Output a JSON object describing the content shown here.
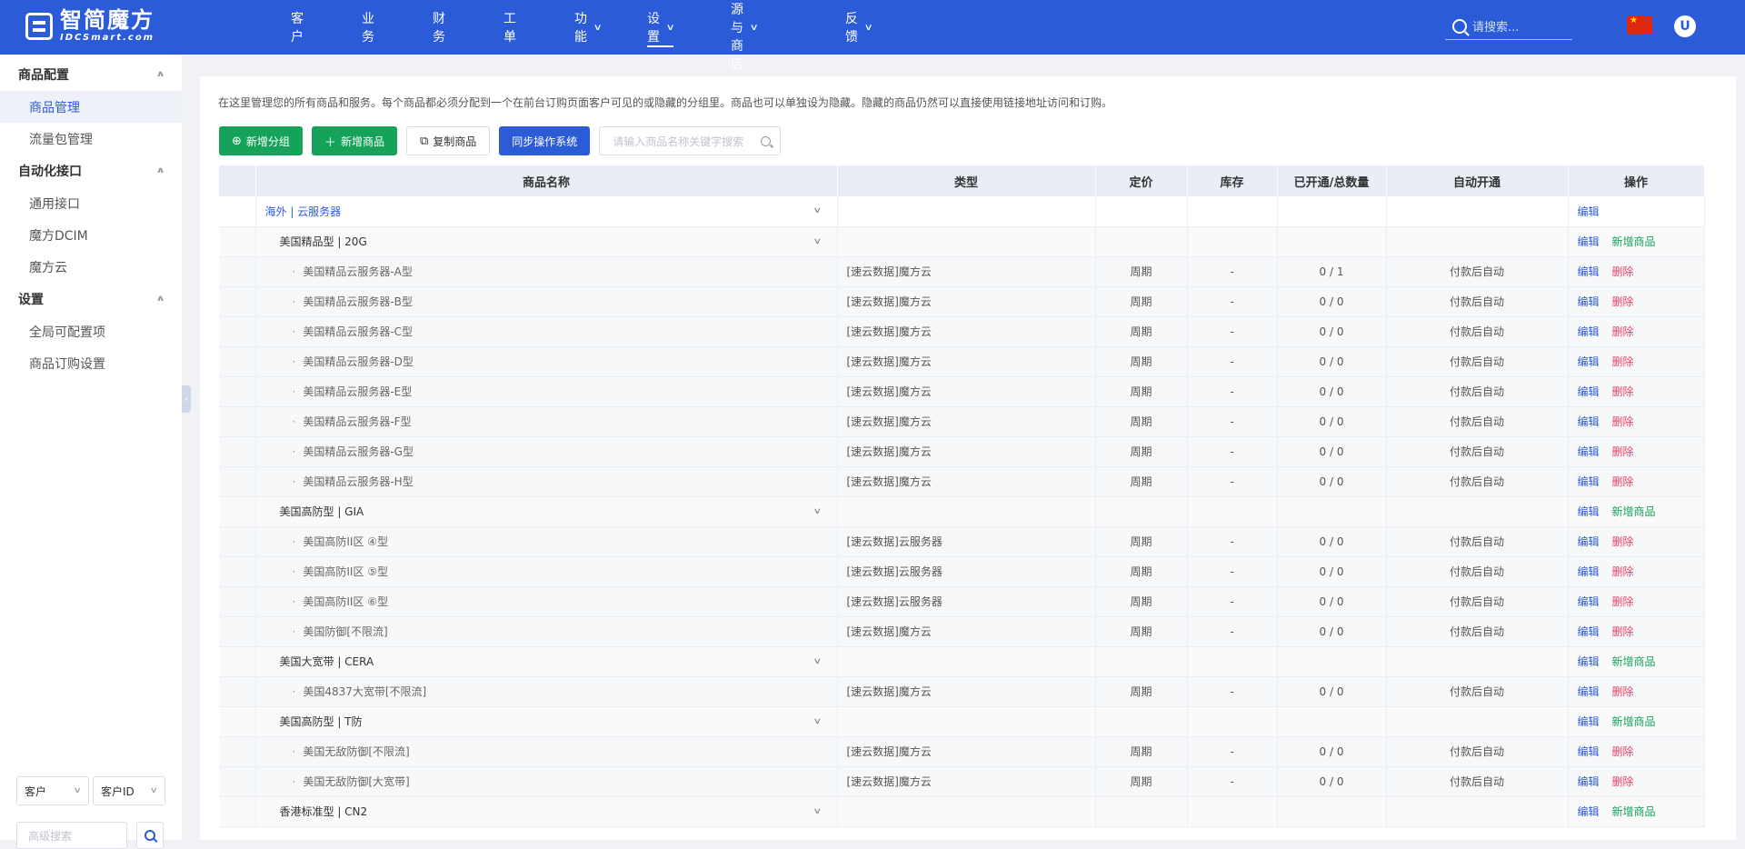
{
  "app": {
    "logo_cn": "智简魔方",
    "logo_en": "IDCSmart.com"
  },
  "nav": {
    "items": [
      {
        "label": "客户",
        "has_chevron": false,
        "active": false
      },
      {
        "label": "业务",
        "has_chevron": false,
        "active": false
      },
      {
        "label": "财务",
        "has_chevron": false,
        "active": false
      },
      {
        "label": "工单",
        "has_chevron": false,
        "active": false
      },
      {
        "label": "功能",
        "has_chevron": true,
        "active": false
      },
      {
        "label": "设置",
        "has_chevron": true,
        "active": true
      },
      {
        "label": "资源与商店",
        "has_chevron": true,
        "active": false
      },
      {
        "label": "反馈",
        "has_chevron": true,
        "active": false
      }
    ],
    "search_placeholder": "请搜索...",
    "avatar_initial": "U"
  },
  "sidebar": {
    "groups": [
      {
        "title": "商品配置",
        "items": [
          {
            "label": "商品管理",
            "active": true
          },
          {
            "label": "流量包管理",
            "active": false
          }
        ]
      },
      {
        "title": "自动化接口",
        "items": [
          {
            "label": "通用接口",
            "active": false
          },
          {
            "label": "魔方DCIM",
            "active": false
          },
          {
            "label": "魔方云",
            "active": false
          }
        ]
      },
      {
        "title": "设置",
        "items": [
          {
            "label": "全局可配置项",
            "active": false
          },
          {
            "label": "商品订购设置",
            "active": false
          }
        ]
      }
    ],
    "filter_select_1": "客户",
    "filter_select_2": "客户ID",
    "advanced_search_placeholder": "高级搜索"
  },
  "main": {
    "description": "在这里管理您的所有商品和服务。每个商品都必须分配到一个在前台订购页面客户可见的或隐藏的分组里。商品也可以单独设为隐藏。隐藏的商品仍然可以直接使用链接地址访问和订购。",
    "toolbar": {
      "add_group": "新增分组",
      "add_product": "新增商品",
      "copy_product": "复制商品",
      "sync_system": "同步操作系统",
      "search_placeholder": "请输入商品名称关键字搜索"
    },
    "columns": [
      "商品名称",
      "类型",
      "定价",
      "库存",
      "已开通/总数量",
      "自动开通",
      "操作"
    ],
    "actions": {
      "edit": "编辑",
      "delete": "删除",
      "add_product": "新增商品"
    },
    "rows": [
      {
        "level": "cat",
        "name": "海外 | 云服务器"
      },
      {
        "level": "grp",
        "name": "美国精品型 | 20G"
      },
      {
        "level": "prod",
        "name": "美国精品云服务器-A型",
        "type": "[速云数据]魔方云",
        "price": "周期",
        "stock": "-",
        "count": "0 / 1",
        "auto": "付款后自动"
      },
      {
        "level": "prod",
        "name": "美国精品云服务器-B型",
        "type": "[速云数据]魔方云",
        "price": "周期",
        "stock": "-",
        "count": "0 / 0",
        "auto": "付款后自动"
      },
      {
        "level": "prod",
        "name": "美国精品云服务器-C型",
        "type": "[速云数据]魔方云",
        "price": "周期",
        "stock": "-",
        "count": "0 / 0",
        "auto": "付款后自动"
      },
      {
        "level": "prod",
        "name": "美国精品云服务器-D型",
        "type": "[速云数据]魔方云",
        "price": "周期",
        "stock": "-",
        "count": "0 / 0",
        "auto": "付款后自动"
      },
      {
        "level": "prod",
        "name": "美国精品云服务器-E型",
        "type": "[速云数据]魔方云",
        "price": "周期",
        "stock": "-",
        "count": "0 / 0",
        "auto": "付款后自动"
      },
      {
        "level": "prod",
        "name": "美国精品云服务器-F型",
        "type": "[速云数据]魔方云",
        "price": "周期",
        "stock": "-",
        "count": "0 / 0",
        "auto": "付款后自动"
      },
      {
        "level": "prod",
        "name": "美国精品云服务器-G型",
        "type": "[速云数据]魔方云",
        "price": "周期",
        "stock": "-",
        "count": "0 / 0",
        "auto": "付款后自动"
      },
      {
        "level": "prod",
        "name": "美国精品云服务器-H型",
        "type": "[速云数据]魔方云",
        "price": "周期",
        "stock": "-",
        "count": "0 / 0",
        "auto": "付款后自动"
      },
      {
        "level": "grp",
        "name": "美国高防型 | GIA"
      },
      {
        "level": "prod",
        "name": "美国高防II区 ④型",
        "type": "[速云数据]云服务器",
        "price": "周期",
        "stock": "-",
        "count": "0 / 0",
        "auto": "付款后自动"
      },
      {
        "level": "prod",
        "name": "美国高防II区 ⑤型",
        "type": "[速云数据]云服务器",
        "price": "周期",
        "stock": "-",
        "count": "0 / 0",
        "auto": "付款后自动"
      },
      {
        "level": "prod",
        "name": "美国高防II区 ⑥型",
        "type": "[速云数据]云服务器",
        "price": "周期",
        "stock": "-",
        "count": "0 / 0",
        "auto": "付款后自动"
      },
      {
        "level": "prod",
        "name": "美国防御[不限流]",
        "type": "[速云数据]魔方云",
        "price": "周期",
        "stock": "-",
        "count": "0 / 0",
        "auto": "付款后自动"
      },
      {
        "level": "grp",
        "name": "美国大宽带 | CERA"
      },
      {
        "level": "prod",
        "name": "美国4837大宽带[不限流]",
        "type": "[速云数据]魔方云",
        "price": "周期",
        "stock": "-",
        "count": "0 / 0",
        "auto": "付款后自动"
      },
      {
        "level": "grp",
        "name": "美国高防型 | T防"
      },
      {
        "level": "prod",
        "name": "美国无敌防御[不限流]",
        "type": "[速云数据]魔方云",
        "price": "周期",
        "stock": "-",
        "count": "0 / 0",
        "auto": "付款后自动"
      },
      {
        "level": "prod",
        "name": "美国无敌防御[大宽带]",
        "type": "[速云数据]魔方云",
        "price": "周期",
        "stock": "-",
        "count": "0 / 0",
        "auto": "付款后自动"
      },
      {
        "level": "grp",
        "name": "香港标准型 | CN2"
      }
    ]
  },
  "colors": {
    "primary": "#2b5bd7",
    "green": "#15a35a",
    "danger": "#e8456b"
  }
}
